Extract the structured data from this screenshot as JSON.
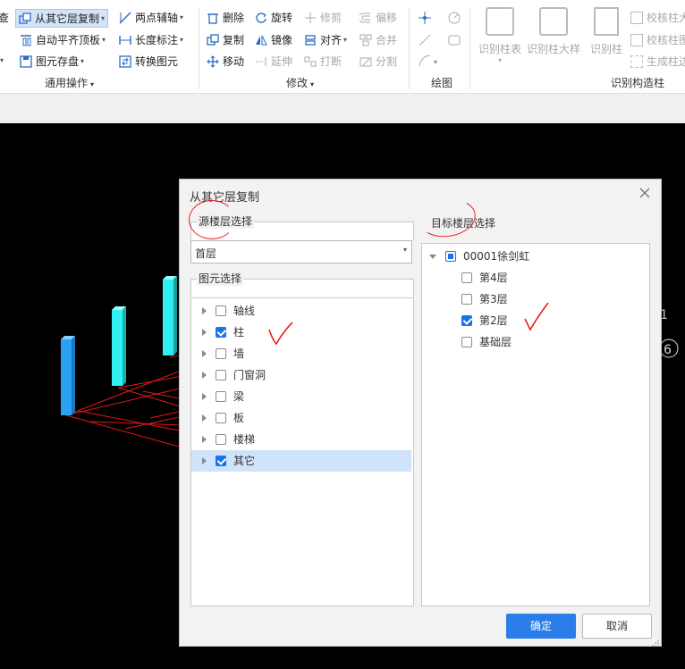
{
  "ribbon": {
    "row1": {
      "query": "查",
      "copy_from_layer": "从其它层复制",
      "two_point_axis": "两点辅轴",
      "delete": "删除",
      "rotate": "旋转",
      "trim": "修剪",
      "offset": "偏移"
    },
    "row2": {
      "auto_level_top": "自动平齐顶板",
      "length_mark": "长度标注",
      "copy": "复制",
      "mirror": "镜像",
      "align": "对齐",
      "merge": "合并"
    },
    "row3": {
      "element_save": "图元存盘",
      "convert_element": "转换图元",
      "move": "移动",
      "extend": "延伸",
      "break": "打断",
      "split": "分割"
    },
    "big_buttons": {
      "identify_column_table": "识别柱表",
      "identify_column_detail": "识别柱大样",
      "identify_column": "识别柱"
    },
    "small_right": {
      "check_column_1": "校核柱大",
      "check_column_2": "校核柱图",
      "generate_column": "生成柱边"
    },
    "groups": {
      "general": "通用操作",
      "modify": "修改",
      "draw": "绘图",
      "identify_structure_column": "识别构造柱"
    }
  },
  "viewport": {
    "label_1": "1",
    "label_6": "6"
  },
  "dialog": {
    "title": "从其它层复制",
    "source_section": "源楼层选择",
    "source_floor": "首层",
    "element_section": "图元选择",
    "elements": [
      {
        "label": "轴线",
        "checked": false
      },
      {
        "label": "柱",
        "checked": true
      },
      {
        "label": "墙",
        "checked": false
      },
      {
        "label": "门窗洞",
        "checked": false
      },
      {
        "label": "梁",
        "checked": false
      },
      {
        "label": "板",
        "checked": false
      },
      {
        "label": "楼梯",
        "checked": false
      },
      {
        "label": "其它",
        "checked": true
      }
    ],
    "target_section": "目标楼层选择",
    "project": "00001徐剑虹",
    "floors": [
      {
        "label": "第4层",
        "checked": false
      },
      {
        "label": "第3层",
        "checked": false
      },
      {
        "label": "第2层",
        "checked": true
      },
      {
        "label": "基础层",
        "checked": false
      }
    ],
    "ok": "确定",
    "cancel": "取消"
  },
  "colors": {
    "accent": "#2b7de9",
    "column_cyan": "#33f0f0",
    "column_blue": "#2aa0f0",
    "grid_red": "#e01818",
    "annotation_red": "#e82020"
  }
}
